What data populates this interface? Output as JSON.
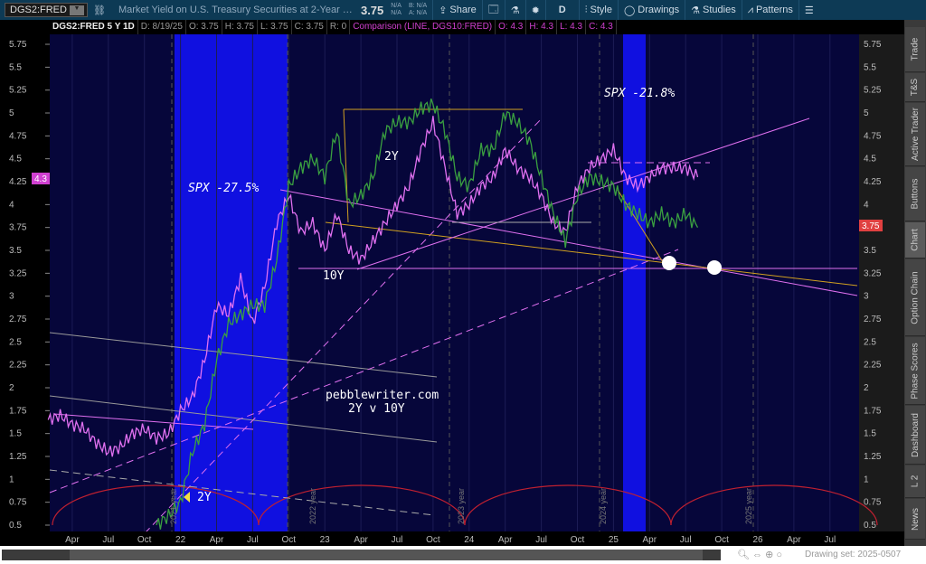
{
  "header": {
    "symbol": "DGS2:FRED",
    "title": "Market Yield on U.S. Treasury Securities at 2-Year Constant Matur...",
    "last": "3.75",
    "na1": "N/A",
    "na2": "N/A",
    "bid": "B: N/A",
    "ask": "A: N/A",
    "share": "Share",
    "period": "D",
    "style": "Style",
    "drawings": "Drawings",
    "studies": "Studies",
    "patterns": "Patterns"
  },
  "info": {
    "sym": "DGS2:FRED 5 Y 1D",
    "d": "D: 8/19/25",
    "o": "O: 3.75",
    "h": "H: 3.75",
    "l": "L: 3.75",
    "c": "C: 3.75",
    "r": "R: 0",
    "comp": "Comparison (LINE, DGS10:FRED)",
    "co": "O: 4.3",
    "ch": "H: 4.3",
    "cl": "L: 4.3",
    "cc": "C: 4.3"
  },
  "sidebar": [
    "Trade",
    "T&S",
    "Active Trader",
    "Buttons",
    "Chart",
    "Option Chain",
    "Phase Scores",
    "Dashboard",
    "L 2",
    "News"
  ],
  "footer": {
    "drawing_set": "Drawing set: 2025-0507"
  },
  "badges": {
    "left": "4.3",
    "right": "3.75"
  },
  "annotations": {
    "spx1": "SPX -27.5%",
    "spx2": "SPX -21.8%",
    "l2y": "2Y",
    "l10y": "10Y",
    "site": "pebblewriter.com",
    "sub": "2Y v 10Y",
    "arrow2y": "2Y",
    "y2021": "2021 year",
    "y2022": "2022 year",
    "y2023": "2023 year",
    "y2024": "2024 year",
    "y2025": "2025 year"
  },
  "colors": {
    "bg": "#06063a",
    "recession": "#1010e0",
    "y2": "#3aa040",
    "y10": "#e070f0",
    "cycle": "#c02030"
  },
  "chart_data": {
    "type": "line",
    "ylim": [
      0.5,
      5.75
    ],
    "yticks": [
      "5.75",
      "5.5",
      "5.25",
      "5",
      "4.75",
      "4.5",
      "4.25",
      "4",
      "3.75",
      "3.5",
      "3.25",
      "3",
      "2.75",
      "2.5",
      "2.25",
      "2",
      "1.75",
      "1.5",
      "1.25",
      "1",
      "0.75",
      "0.5"
    ],
    "xticks": [
      {
        "label": "Apr",
        "m": 3
      },
      {
        "label": "Jul",
        "m": 6
      },
      {
        "label": "Oct",
        "m": 9
      },
      {
        "label": "22",
        "m": 12
      },
      {
        "label": "Apr",
        "m": 15
      },
      {
        "label": "Jul",
        "m": 18
      },
      {
        "label": "Oct",
        "m": 21
      },
      {
        "label": "23",
        "m": 24
      },
      {
        "label": "Apr",
        "m": 27
      },
      {
        "label": "Jul",
        "m": 30
      },
      {
        "label": "Oct",
        "m": 33
      },
      {
        "label": "24",
        "m": 36
      },
      {
        "label": "Apr",
        "m": 39
      },
      {
        "label": "Jul",
        "m": 42
      },
      {
        "label": "Oct",
        "m": 45
      },
      {
        "label": "25",
        "m": 48
      },
      {
        "label": "Apr",
        "m": 51
      },
      {
        "label": "Jul",
        "m": 54
      },
      {
        "label": "Oct",
        "m": 57
      },
      {
        "label": "26",
        "m": 60
      },
      {
        "label": "Apr",
        "m": 63
      },
      {
        "label": "Jul",
        "m": 66
      }
    ],
    "series": [
      {
        "name": "DGS10:FRED",
        "start_month": 1,
        "values": [
          1.65,
          1.7,
          1.6,
          1.55,
          1.4,
          1.3,
          1.35,
          1.5,
          1.55,
          1.45,
          1.5,
          1.75,
          1.9,
          2.3,
          2.9,
          2.8,
          3.2,
          2.7,
          3.1,
          3.8,
          4.1,
          3.7,
          3.8,
          3.5,
          3.9,
          3.5,
          3.4,
          3.6,
          3.8,
          4.0,
          4.2,
          4.6,
          4.9,
          4.4,
          3.9,
          4.0,
          4.2,
          4.3,
          4.6,
          4.4,
          4.3,
          4.1,
          3.8,
          3.7,
          4.2,
          4.4,
          4.5,
          4.6,
          4.3,
          4.2,
          4.3,
          4.4,
          4.4,
          4.4,
          4.3
        ]
      },
      {
        "name": "DGS2:FRED",
        "start_month": 10,
        "values": [
          0.5,
          0.6,
          0.75,
          1.3,
          1.6,
          2.3,
          2.7,
          2.8,
          2.9,
          2.9,
          3.4,
          4.2,
          4.4,
          4.5,
          4.3,
          4.8,
          4.0,
          4.1,
          4.3,
          4.8,
          4.9,
          4.9,
          5.05,
          5.1,
          4.8,
          4.3,
          4.2,
          4.6,
          4.6,
          5.0,
          4.9,
          4.7,
          4.3,
          3.9,
          3.6,
          4.1,
          4.3,
          4.25,
          4.2,
          4.0,
          3.9,
          3.8,
          3.9,
          3.8,
          3.9,
          3.75
        ]
      }
    ]
  }
}
